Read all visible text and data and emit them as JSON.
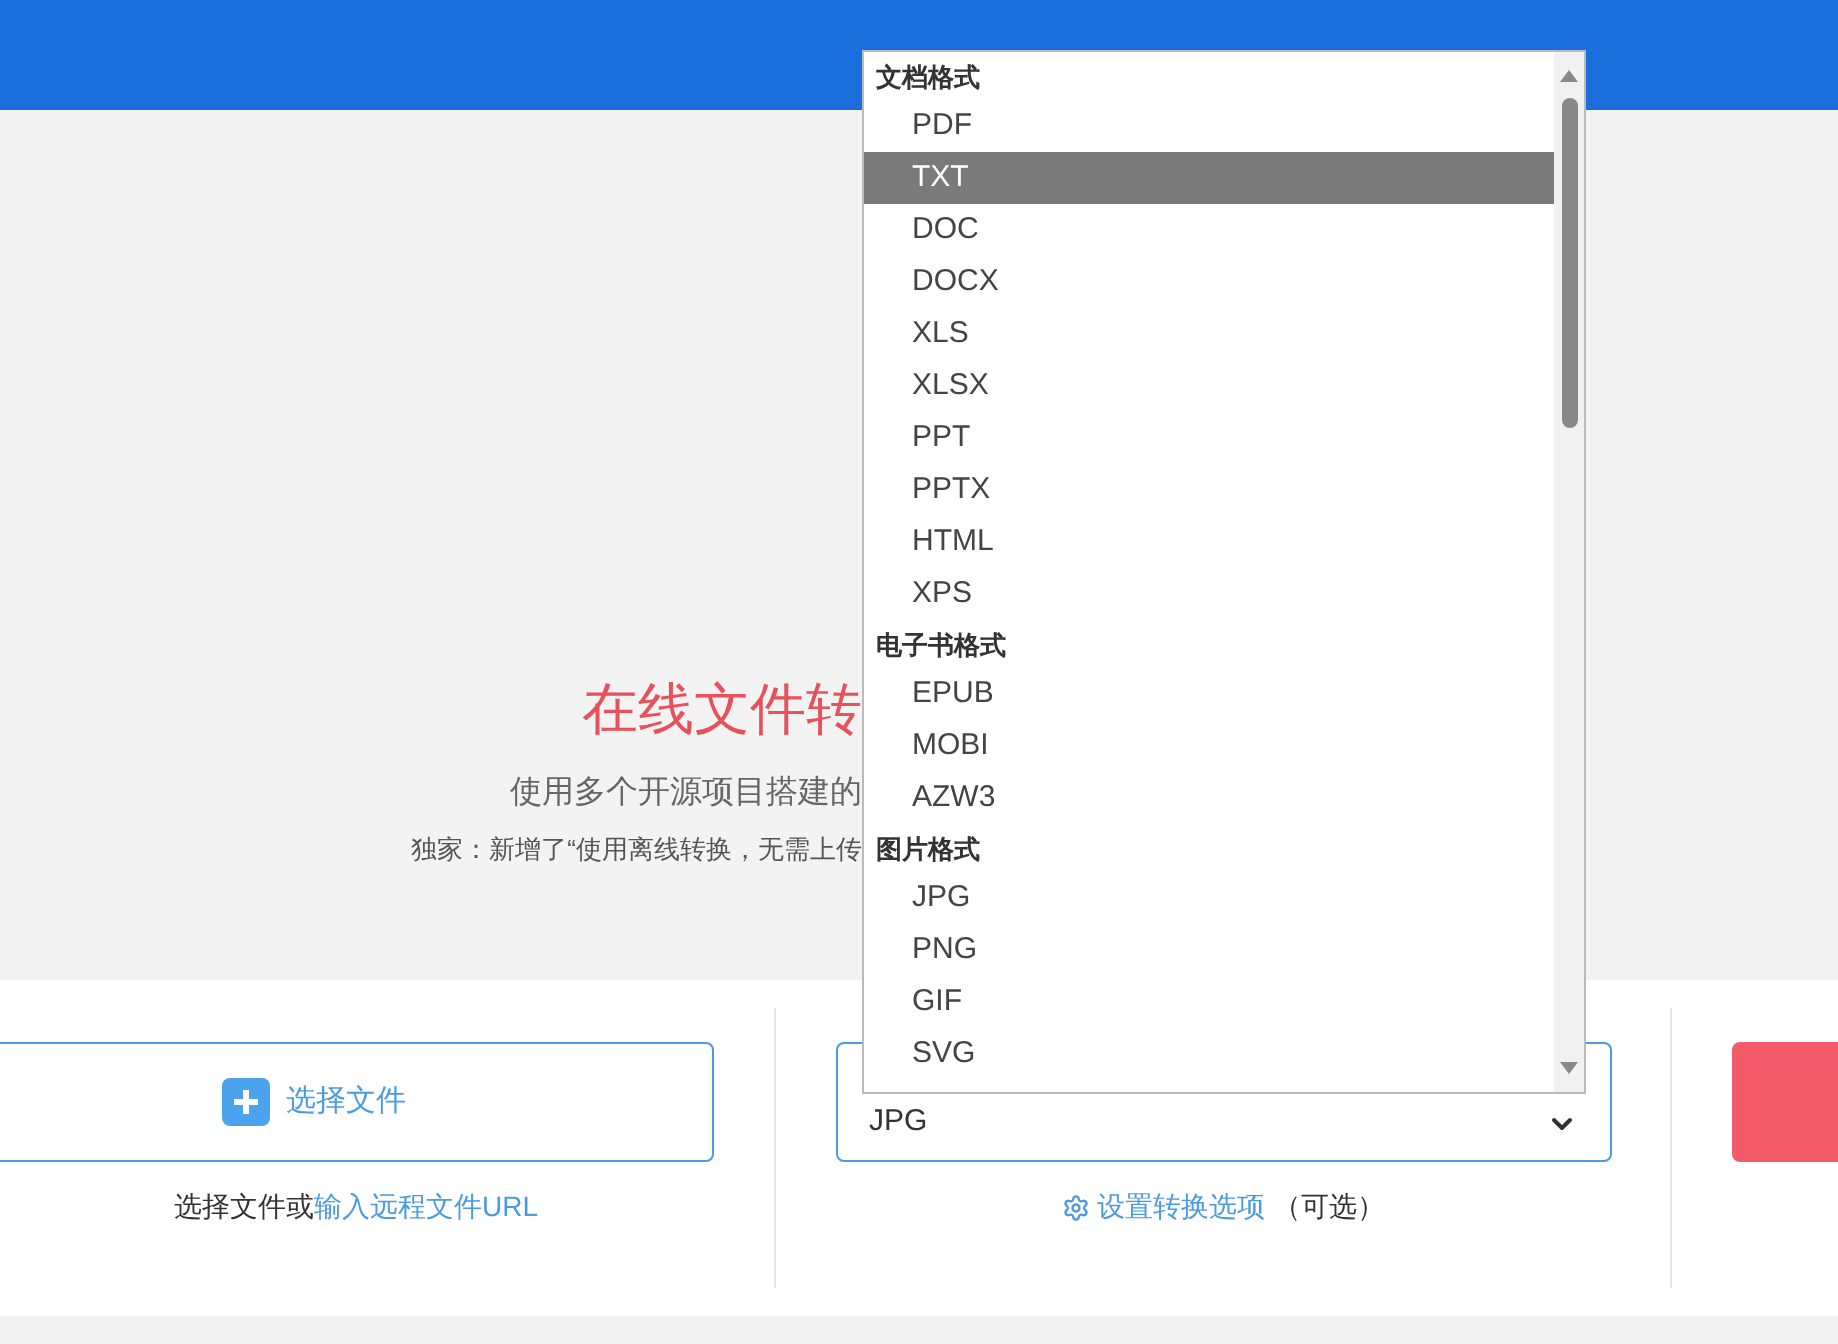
{
  "hero": {
    "title": "在线文件转",
    "subtitle": "使用多个开源项目搭建的",
    "notice": "独家：新增了“使用离线转换，无需上传"
  },
  "upload": {
    "button": "选择文件",
    "hint_prefix": "选择文件或",
    "hint_link": "输入远程文件URL"
  },
  "format_select": {
    "value": "JPG",
    "options_link": "设置转换选项",
    "options_note": "（可选）"
  },
  "dropdown": {
    "groups": [
      {
        "label": "文档格式",
        "options": [
          {
            "label": "PDF",
            "selected": false
          },
          {
            "label": "TXT",
            "selected": true
          },
          {
            "label": "DOC",
            "selected": false
          },
          {
            "label": "DOCX",
            "selected": false
          },
          {
            "label": "XLS",
            "selected": false
          },
          {
            "label": "XLSX",
            "selected": false
          },
          {
            "label": "PPT",
            "selected": false
          },
          {
            "label": "PPTX",
            "selected": false
          },
          {
            "label": "HTML",
            "selected": false
          },
          {
            "label": "XPS",
            "selected": false
          }
        ]
      },
      {
        "label": "电子书格式",
        "options": [
          {
            "label": "EPUB",
            "selected": false
          },
          {
            "label": "MOBI",
            "selected": false
          },
          {
            "label": "AZW3",
            "selected": false
          }
        ]
      },
      {
        "label": "图片格式",
        "options": [
          {
            "label": "JPG",
            "selected": false
          },
          {
            "label": "PNG",
            "selected": false
          },
          {
            "label": "GIF",
            "selected": false
          },
          {
            "label": "SVG",
            "selected": false
          }
        ]
      }
    ]
  }
}
